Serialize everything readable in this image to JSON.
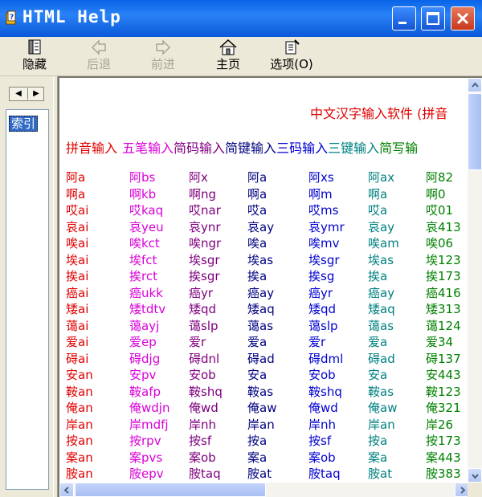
{
  "window": {
    "title": "HTML Help"
  },
  "toolbar": [
    {
      "label": "隐藏",
      "icon": "hide-icon",
      "enabled": true
    },
    {
      "label": "后退",
      "icon": "back-arrow-icon",
      "enabled": false
    },
    {
      "label": "前进",
      "icon": "forward-arrow-icon",
      "enabled": false
    },
    {
      "label": "主页",
      "icon": "home-icon",
      "enabled": true
    },
    {
      "label": "选项(O)",
      "icon": "options-icon",
      "enabled": true
    }
  ],
  "nav": {
    "selected_tab": "索引"
  },
  "content": {
    "title": "中文汉字输入软件 (拼音",
    "methods": [
      {
        "label": "拼音输入",
        "color": "#e00000"
      },
      {
        "label": "五笔输入",
        "color": "#d800d8"
      },
      {
        "label": "简码输入",
        "color": "#800080"
      },
      {
        "label": "简键输入",
        "color": "#000080"
      },
      {
        "label": "三码输入",
        "color": "#0000d0"
      },
      {
        "label": "三键输入",
        "color": "#008080"
      },
      {
        "label": "简写输",
        "color": "#008000"
      }
    ],
    "columns": [
      {
        "color": "#e00000",
        "entries": [
          "阿a",
          "啊a",
          "哎ai",
          "哀ai",
          "唉ai",
          "埃ai",
          "挨ai",
          "癌ai",
          "矮ai",
          "蔼ai",
          "爱ai",
          "碍ai",
          "安an",
          "鞍an",
          "俺an",
          "岸an",
          "按an",
          "案an",
          "胺an"
        ]
      },
      {
        "color": "#d800d8",
        "entries": [
          "阿bs",
          "啊kb",
          "哎kaq",
          "哀yeu",
          "唉kct",
          "埃fct",
          "挨rct",
          "癌ukk",
          "矮tdtv",
          "蔼ayj",
          "爱ep",
          "碍djg",
          "安pv",
          "鞍afp",
          "俺wdjn",
          "岸mdfj",
          "按rpv",
          "案pvs",
          "胺epv"
        ]
      },
      {
        "color": "#800080",
        "entries": [
          "阿x",
          "啊ng",
          "哎nar",
          "哀ynr",
          "唉ngr",
          "埃sgr",
          "挨sgr",
          "癌yr",
          "矮qd",
          "蔼slp",
          "爱r",
          "碍dnl",
          "安ob",
          "鞍shq",
          "俺wd",
          "岸nh",
          "按sf",
          "案ob",
          "胺taq"
        ]
      },
      {
        "color": "#000080",
        "entries": [
          "阿a",
          "啊a",
          "哎a",
          "哀ay",
          "唉a",
          "埃as",
          "挨a",
          "癌ay",
          "矮aq",
          "蔼as",
          "爱a",
          "碍ad",
          "安a",
          "鞍as",
          "俺aw",
          "岸an",
          "按a",
          "案a",
          "胺at"
        ]
      },
      {
        "color": "#0000d0",
        "entries": [
          "阿xs",
          "啊m",
          "哎ms",
          "哀ymr",
          "唉mv",
          "埃sgr",
          "挨sg",
          "癌yr",
          "矮qd",
          "蔼slp",
          "爱r",
          "碍dml",
          "安ob",
          "鞍shq",
          "俺wd",
          "岸nh",
          "按sf",
          "案ob",
          "胺taq"
        ]
      },
      {
        "color": "#008080",
        "entries": [
          "阿ax",
          "啊a",
          "哎a",
          "哀ay",
          "唉am",
          "埃as",
          "挨a",
          "癌ay",
          "矮aq",
          "蔼as",
          "爱a",
          "碍ad",
          "安a",
          "鞍as",
          "俺aw",
          "岸an",
          "按a",
          "案a",
          "胺at"
        ]
      },
      {
        "color": "#008000",
        "entries": [
          "阿82",
          "啊0",
          "哎01",
          "哀413",
          "唉06",
          "埃123",
          "挨173",
          "癌416",
          "矮313",
          "蔼124",
          "爱34",
          "碍137",
          "安443",
          "鞍123",
          "俺321",
          "岸26",
          "按173",
          "案443",
          "胺383"
        ]
      }
    ]
  }
}
